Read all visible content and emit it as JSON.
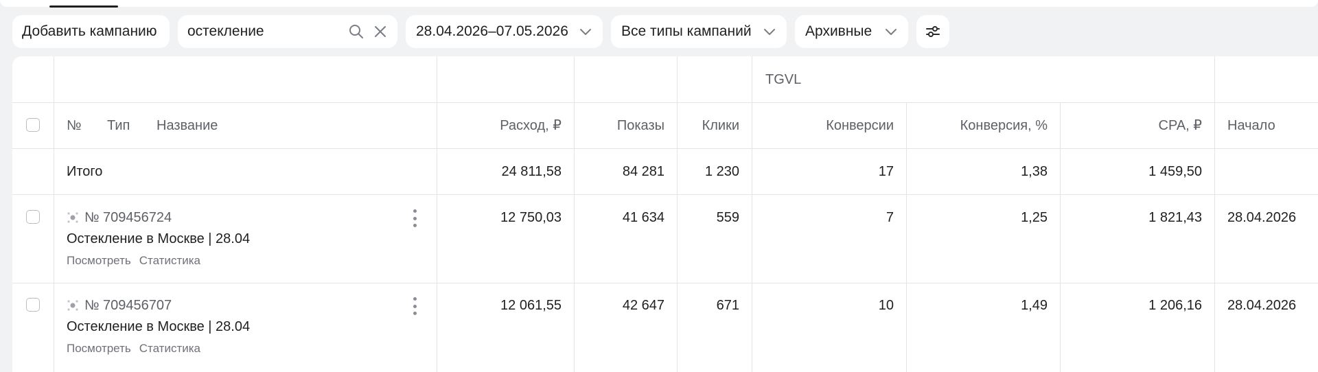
{
  "toolbar": {
    "add_campaign": "Добавить кампанию",
    "search_value": "остекление",
    "date_range": "28.04.2026–07.05.2026",
    "campaign_types": "Все типы кампаний",
    "archive_filter": "Архивные"
  },
  "table": {
    "group_header": "TGVL",
    "columns": {
      "num": "№",
      "type": "Тип",
      "name": "Название",
      "spend": "Расход, ₽",
      "impressions": "Показы",
      "clicks": "Клики",
      "conversions": "Конверсии",
      "conv_rate": "Конверсия, %",
      "cpa": "CPA, ₽",
      "start": "Начало"
    },
    "total": {
      "label": "Итого",
      "spend": "24 811,58",
      "impressions": "84 281",
      "clicks": "1 230",
      "conversions": "17",
      "conv_rate": "1,38",
      "cpa": "1 459,50"
    },
    "rows": [
      {
        "id": "№ 709456724",
        "name": "Остекление в Москве | 28.04",
        "link_view": "Посмотреть",
        "link_stats": "Статистика",
        "spend": "12 750,03",
        "impressions": "41 634",
        "clicks": "559",
        "conversions": "7",
        "conv_rate": "1,25",
        "cpa": "1 821,43",
        "start": "28.04.2026"
      },
      {
        "id": "№ 709456707",
        "name": "Остекление в Москве | 28.04",
        "link_view": "Посмотреть",
        "link_stats": "Статистика",
        "spend": "12 061,55",
        "impressions": "42 647",
        "clicks": "671",
        "conversions": "10",
        "conv_rate": "1,49",
        "cpa": "1 206,16",
        "start": "28.04.2026"
      }
    ]
  }
}
